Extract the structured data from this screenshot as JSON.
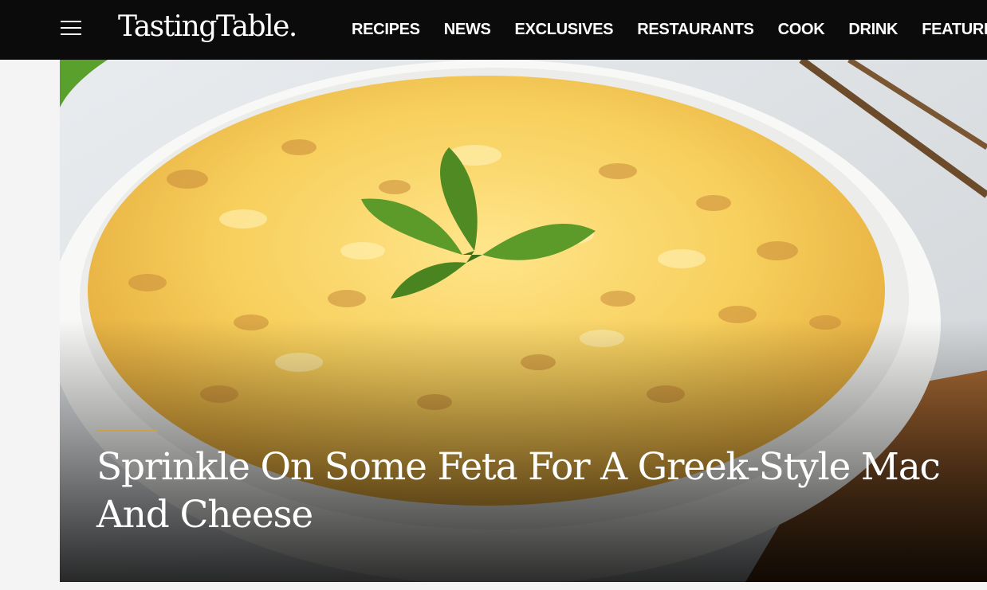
{
  "header": {
    "logo_text": "TastingTable.",
    "nav": [
      {
        "label": "RECIPES"
      },
      {
        "label": "NEWS"
      },
      {
        "label": "EXCLUSIVES"
      },
      {
        "label": "RESTAURANTS"
      },
      {
        "label": "COOK"
      },
      {
        "label": "DRINK"
      },
      {
        "label": "FEATURES"
      }
    ]
  },
  "hero": {
    "headline": "Sprinkle On Some Feta For A Greek-Style Mac And Cheese",
    "accent_color": "#c9a24b"
  },
  "colors": {
    "topbar": "#0b0b0b",
    "page_bg": "#f4f4f4",
    "text": "#ffffff"
  }
}
